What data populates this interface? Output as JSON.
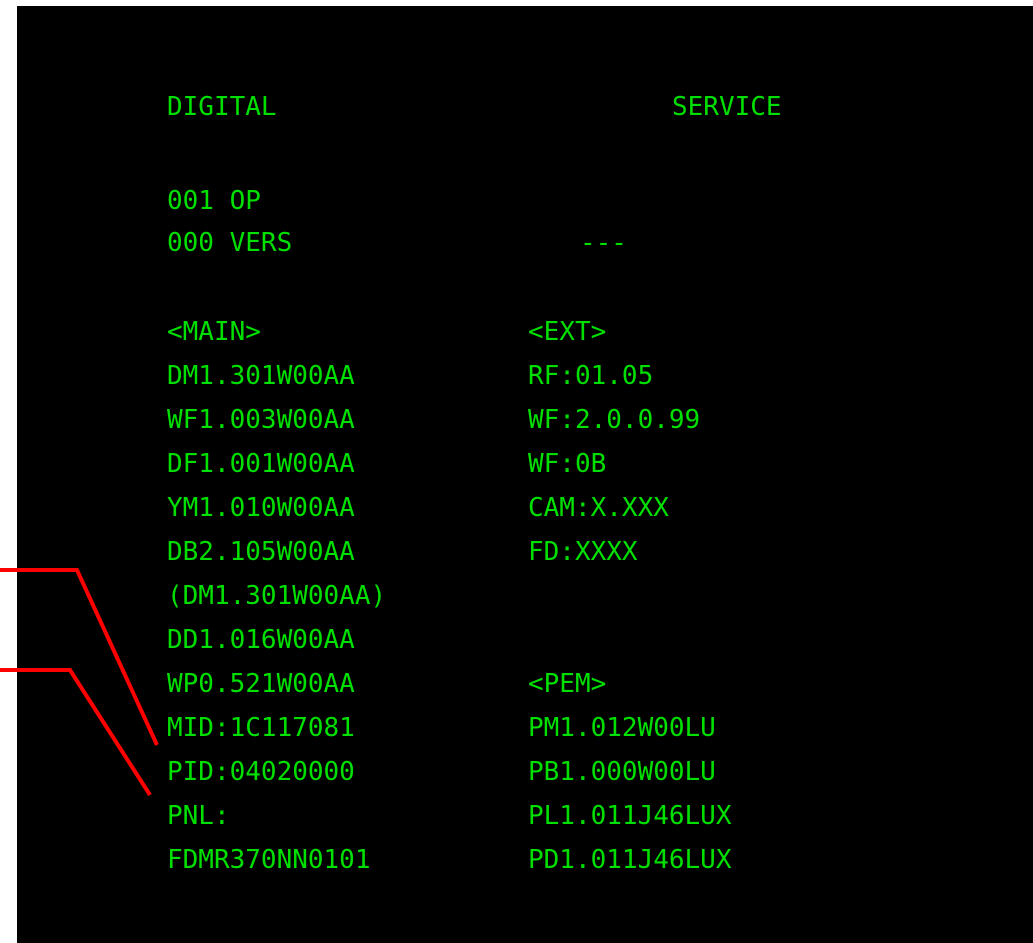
{
  "header": {
    "title_left": "DIGITAL",
    "title_right": "SERVICE"
  },
  "op_line": "001 OP",
  "vers_line": {
    "label": "000 VERS",
    "value": "---"
  },
  "main_section": {
    "heading": "<MAIN>",
    "items": [
      "DM1.301W00AA",
      "WF1.003W00AA",
      "DF1.001W00AA",
      "YM1.010W00AA",
      "DB2.105W00AA",
      "(DM1.301W00AA)",
      "DD1.016W00AA",
      "WP0.521W00AA",
      "MID:1C117081",
      "PID:04020000",
      "PNL:",
      "FDMR370NN0101"
    ]
  },
  "ext_section": {
    "heading": "<EXT>",
    "items": [
      "RF:01.05",
      "WF:2.0.0.99",
      "WF:0B",
      "CAM:X.XXX",
      "FD:XXXX"
    ]
  },
  "pem_section": {
    "heading": "<PEM>",
    "items": [
      "PM1.012W00LU",
      "PB1.000W00LU",
      "PL1.011J46LUX",
      "PD1.011J46LUX"
    ]
  },
  "colors": {
    "text": "#00e000",
    "background": "#000000",
    "leader_lines": "#ff0000"
  }
}
